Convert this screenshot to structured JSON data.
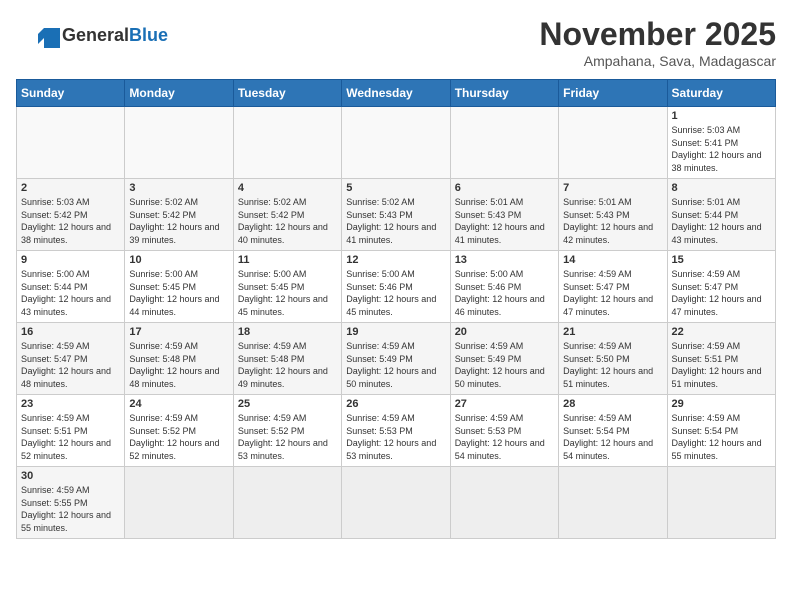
{
  "header": {
    "logo_general": "General",
    "logo_blue": "Blue",
    "title": "November 2025",
    "subtitle": "Ampahana, Sava, Madagascar"
  },
  "days_of_week": [
    "Sunday",
    "Monday",
    "Tuesday",
    "Wednesday",
    "Thursday",
    "Friday",
    "Saturday"
  ],
  "weeks": [
    [
      {
        "day": "",
        "info": ""
      },
      {
        "day": "",
        "info": ""
      },
      {
        "day": "",
        "info": ""
      },
      {
        "day": "",
        "info": ""
      },
      {
        "day": "",
        "info": ""
      },
      {
        "day": "",
        "info": ""
      },
      {
        "day": "1",
        "info": "Sunrise: 5:03 AM\nSunset: 5:41 PM\nDaylight: 12 hours and 38 minutes."
      }
    ],
    [
      {
        "day": "2",
        "info": "Sunrise: 5:03 AM\nSunset: 5:42 PM\nDaylight: 12 hours and 38 minutes."
      },
      {
        "day": "3",
        "info": "Sunrise: 5:02 AM\nSunset: 5:42 PM\nDaylight: 12 hours and 39 minutes."
      },
      {
        "day": "4",
        "info": "Sunrise: 5:02 AM\nSunset: 5:42 PM\nDaylight: 12 hours and 40 minutes."
      },
      {
        "day": "5",
        "info": "Sunrise: 5:02 AM\nSunset: 5:43 PM\nDaylight: 12 hours and 41 minutes."
      },
      {
        "day": "6",
        "info": "Sunrise: 5:01 AM\nSunset: 5:43 PM\nDaylight: 12 hours and 41 minutes."
      },
      {
        "day": "7",
        "info": "Sunrise: 5:01 AM\nSunset: 5:43 PM\nDaylight: 12 hours and 42 minutes."
      },
      {
        "day": "8",
        "info": "Sunrise: 5:01 AM\nSunset: 5:44 PM\nDaylight: 12 hours and 43 minutes."
      }
    ],
    [
      {
        "day": "9",
        "info": "Sunrise: 5:00 AM\nSunset: 5:44 PM\nDaylight: 12 hours and 43 minutes."
      },
      {
        "day": "10",
        "info": "Sunrise: 5:00 AM\nSunset: 5:45 PM\nDaylight: 12 hours and 44 minutes."
      },
      {
        "day": "11",
        "info": "Sunrise: 5:00 AM\nSunset: 5:45 PM\nDaylight: 12 hours and 45 minutes."
      },
      {
        "day": "12",
        "info": "Sunrise: 5:00 AM\nSunset: 5:46 PM\nDaylight: 12 hours and 45 minutes."
      },
      {
        "day": "13",
        "info": "Sunrise: 5:00 AM\nSunset: 5:46 PM\nDaylight: 12 hours and 46 minutes."
      },
      {
        "day": "14",
        "info": "Sunrise: 4:59 AM\nSunset: 5:47 PM\nDaylight: 12 hours and 47 minutes."
      },
      {
        "day": "15",
        "info": "Sunrise: 4:59 AM\nSunset: 5:47 PM\nDaylight: 12 hours and 47 minutes."
      }
    ],
    [
      {
        "day": "16",
        "info": "Sunrise: 4:59 AM\nSunset: 5:47 PM\nDaylight: 12 hours and 48 minutes."
      },
      {
        "day": "17",
        "info": "Sunrise: 4:59 AM\nSunset: 5:48 PM\nDaylight: 12 hours and 48 minutes."
      },
      {
        "day": "18",
        "info": "Sunrise: 4:59 AM\nSunset: 5:48 PM\nDaylight: 12 hours and 49 minutes."
      },
      {
        "day": "19",
        "info": "Sunrise: 4:59 AM\nSunset: 5:49 PM\nDaylight: 12 hours and 50 minutes."
      },
      {
        "day": "20",
        "info": "Sunrise: 4:59 AM\nSunset: 5:49 PM\nDaylight: 12 hours and 50 minutes."
      },
      {
        "day": "21",
        "info": "Sunrise: 4:59 AM\nSunset: 5:50 PM\nDaylight: 12 hours and 51 minutes."
      },
      {
        "day": "22",
        "info": "Sunrise: 4:59 AM\nSunset: 5:51 PM\nDaylight: 12 hours and 51 minutes."
      }
    ],
    [
      {
        "day": "23",
        "info": "Sunrise: 4:59 AM\nSunset: 5:51 PM\nDaylight: 12 hours and 52 minutes."
      },
      {
        "day": "24",
        "info": "Sunrise: 4:59 AM\nSunset: 5:52 PM\nDaylight: 12 hours and 52 minutes."
      },
      {
        "day": "25",
        "info": "Sunrise: 4:59 AM\nSunset: 5:52 PM\nDaylight: 12 hours and 53 minutes."
      },
      {
        "day": "26",
        "info": "Sunrise: 4:59 AM\nSunset: 5:53 PM\nDaylight: 12 hours and 53 minutes."
      },
      {
        "day": "27",
        "info": "Sunrise: 4:59 AM\nSunset: 5:53 PM\nDaylight: 12 hours and 54 minutes."
      },
      {
        "day": "28",
        "info": "Sunrise: 4:59 AM\nSunset: 5:54 PM\nDaylight: 12 hours and 54 minutes."
      },
      {
        "day": "29",
        "info": "Sunrise: 4:59 AM\nSunset: 5:54 PM\nDaylight: 12 hours and 55 minutes."
      }
    ],
    [
      {
        "day": "30",
        "info": "Sunrise: 4:59 AM\nSunset: 5:55 PM\nDaylight: 12 hours and 55 minutes."
      },
      {
        "day": "",
        "info": ""
      },
      {
        "day": "",
        "info": ""
      },
      {
        "day": "",
        "info": ""
      },
      {
        "day": "",
        "info": ""
      },
      {
        "day": "",
        "info": ""
      },
      {
        "day": "",
        "info": ""
      }
    ]
  ]
}
